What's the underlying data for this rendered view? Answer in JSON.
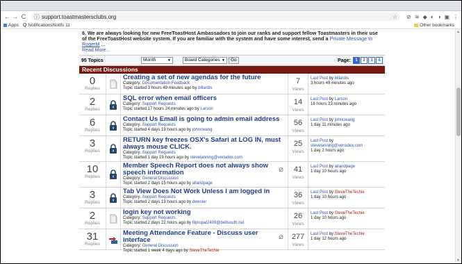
{
  "browser": {
    "url": "support.toastmastersclubs.org",
    "bookmarks": [
      {
        "label": "Apps"
      },
      {
        "label": "NotificationsNotifs 11"
      }
    ],
    "other_bookmarks": "Other bookmarks"
  },
  "announcement": {
    "text": "6. We are always looking for new FreeToastHost Ambassadors to join our ranks and support fellow Toastmasters in their use of the FreeToastHost website system. If you are familiar with the system and have some interest, send a",
    "link1": "Private Message to",
    "link2": "RogerM",
    "ellipsis": "...",
    "read_more": "Read More..."
  },
  "controls": {
    "topics_count": "95 Topics",
    "period_select": "Month",
    "category_select": "Board Categories",
    "go_label": "Go",
    "page_label": "Page:",
    "pages": [
      "1",
      "2",
      "3",
      "4"
    ]
  },
  "section_title": "Recent Discussions",
  "labels": {
    "replies": "Replies",
    "views": "Views",
    "category": "Category:",
    "last_post": "Last Post",
    "by": "by"
  },
  "topics": [
    {
      "replies": "0",
      "title": "Creating a set of new agendas for the future",
      "category": "Documentation Feedback",
      "started_prefix": "Topic started 3 hours 49 minutes ago by",
      "starter": "billardis",
      "views": "7",
      "last_by": "billardis",
      "last_time": "3 hours 49 minutes ago"
    },
    {
      "replies": "2",
      "title": "SQL error when email officers",
      "category": "Support Requests",
      "started_prefix": "Topic started 17 hours 24 minutes ago by",
      "starter": "Larson",
      "views": "14",
      "last_by": "Larson",
      "last_time": "16 hours 23 minutes ago"
    },
    {
      "replies": "6",
      "title": "Contact Us Email is going to admin email address",
      "category": "Support Requests",
      "started_prefix": "Topic started 4 days 19 hours ago by",
      "starter": "johncwang",
      "views": "56",
      "last_by": "johncwang",
      "last_time": "1 day 11 minutes ago"
    },
    {
      "replies": "3",
      "title": "RETURN key freezes OSX's Safari at LOG IN, must always mouse CLICK.",
      "category": "Support Requests",
      "started_prefix": "Topic started 1 day 19 hours ago by",
      "starter": "stevelanning@versidex.com",
      "views": "25",
      "last_by": "stevelanning@versidex.com",
      "last_time": "1 day 2 hours ago"
    },
    {
      "replies": "10",
      "title": "Member Speech Report does not always show speech information",
      "category": "General Discussion",
      "started_prefix": "Topic started 2 days 15 hours ago by",
      "starter": "allandpage",
      "views": "41",
      "last_by": "allandpage",
      "last_time": "1 day 10 hours ago"
    },
    {
      "replies": "3",
      "title": "Tab View Does Not Work Unless I am logged in",
      "category": "Support Requests",
      "started_prefix": "Topic started 2 days 19 hours ago by",
      "starter": "dwesler",
      "views": "36",
      "last_by": "SteveTheTechie",
      "last_time": "1 day 10 hours ago"
    },
    {
      "replies": "2",
      "title": "login key not working",
      "category": "Support Requests",
      "started_prefix": "Topic started 2 days 22 hours ago by",
      "starter": "filpropat2409@bellsouth.net",
      "views": "26",
      "last_by": "SteveTheTechie",
      "last_time": "1 day 10 hours ago"
    },
    {
      "replies": "31",
      "title": "Meeting Attendance Feature - Discuss user interface",
      "category": "General Discussion",
      "started_prefix": "Topic started 1 week 4 days ago by",
      "starter": "SteveTheTechie",
      "views": "277",
      "last_by": "SteveTheTechie",
      "last_time": "1 day 12 hours ago"
    }
  ]
}
